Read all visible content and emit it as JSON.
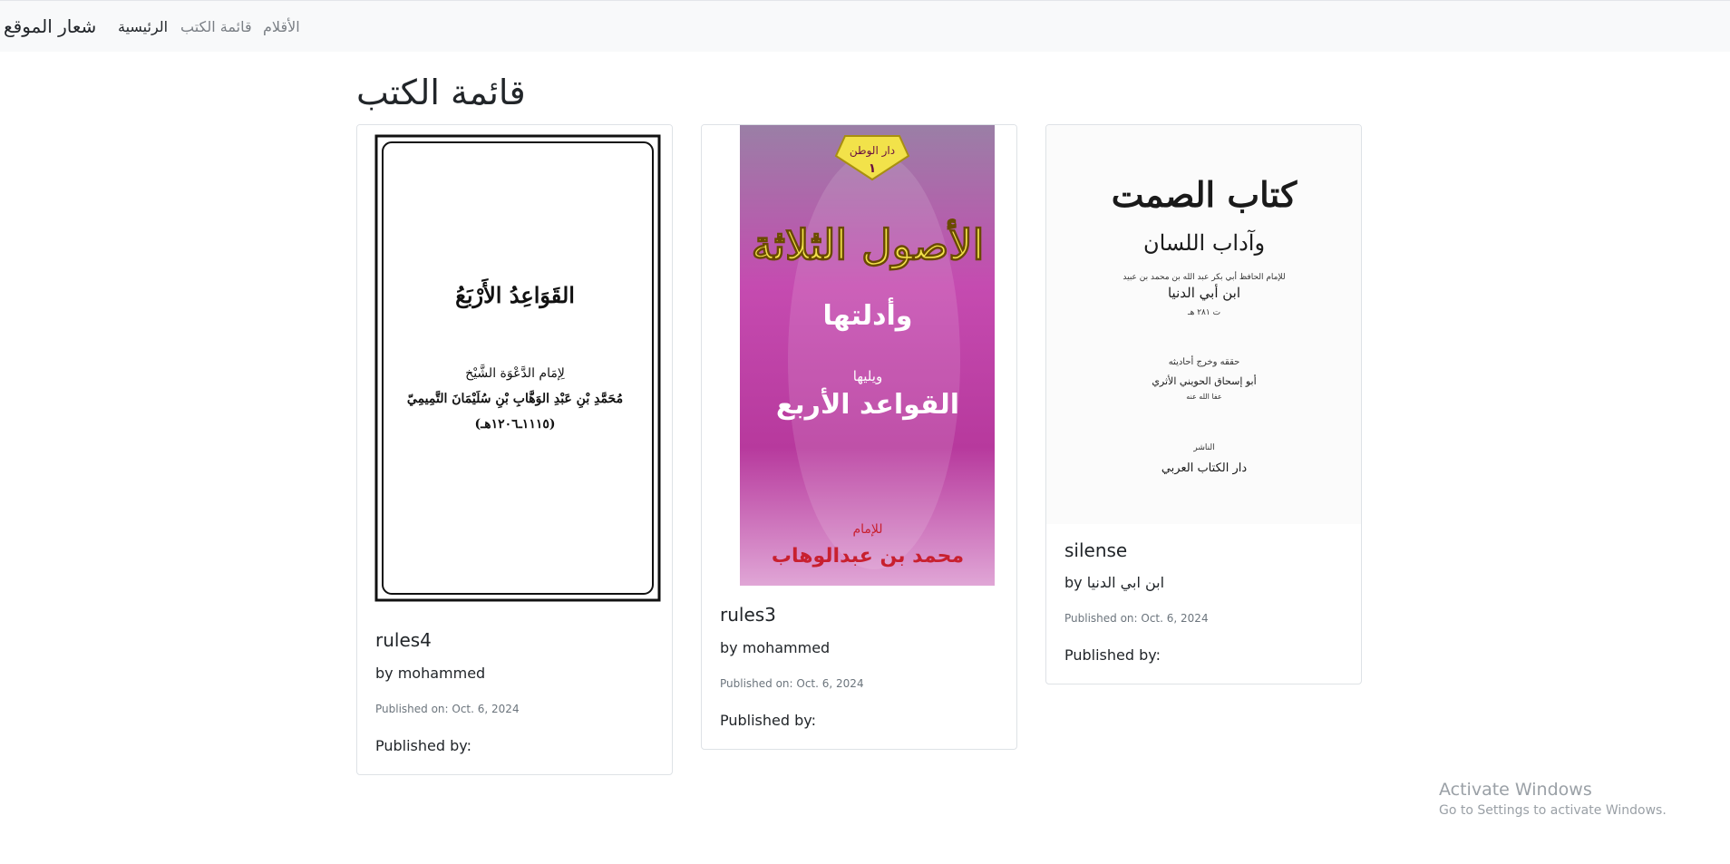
{
  "navbar": {
    "brand": "شعار الموقع",
    "links": [
      "الرئيسية",
      "قائمة الكتب",
      "الأقلام"
    ]
  },
  "page": {
    "title": "قائمة الكتب"
  },
  "books": [
    {
      "title": "rules4",
      "author": "by mohammed",
      "published": "Published on: Oct. 6, 2024",
      "publisher": "Published by:",
      "cover_text": {
        "title": "القَوَاعِدُ الأَرْبَعُ",
        "line1": "لِإمَام الدَّعْوَة الشَّيْخ",
        "line2": "مُحَمَّدِ بْنِ عَبْدِ الوَهَّابِ بْنِ سُلَيْمَانَ التَّمِيمِيّ",
        "line3": "(١١١٥ـ١٢٠٦هـ)"
      }
    },
    {
      "title": "rules3",
      "author": "by mohammed",
      "published": "Published on: Oct. 6, 2024",
      "publisher": "Published by:",
      "cover_text": {
        "badge_top": "دار الوطن",
        "badge_num": "١",
        "title": "الأصول الثلاثة",
        "subtitle": "وأدلتها",
        "follow": "ويليها",
        "second_title": "القواعد الأربع",
        "imam": "للإمام",
        "author": "محمد بن عبدالوهاب"
      }
    },
    {
      "title": "silense",
      "author": "by ابن ابي الدنيا",
      "published": "Published on: Oct. 6, 2024",
      "publisher": "Published by:",
      "cover_text": {
        "title": "كتاب الصمت",
        "subtitle": "وآداب اللسان",
        "line1": "للإمام الحافظ أبي بكر عبد الله بن محمد بن عبيد",
        "line2": "ابن أبي الدنيا",
        "line3": "ت ٢٨١ هـ",
        "line4": "حققه وخرج أحاديثه",
        "line5": "أبو إسحاق الحويني الأثري",
        "line6": "عفا الله عنه",
        "line7": "الناشر",
        "line8": "دار الكتاب العربي"
      }
    }
  ],
  "watermark": {
    "line1": "Activate Windows",
    "line2": "Go to Settings to activate Windows."
  },
  "colors": {
    "navbar_bg": "#f8f9fa",
    "cover2_pink": "#c13aa4",
    "cover2_gold": "#f2e24a",
    "cover2_red": "#c8202f"
  }
}
